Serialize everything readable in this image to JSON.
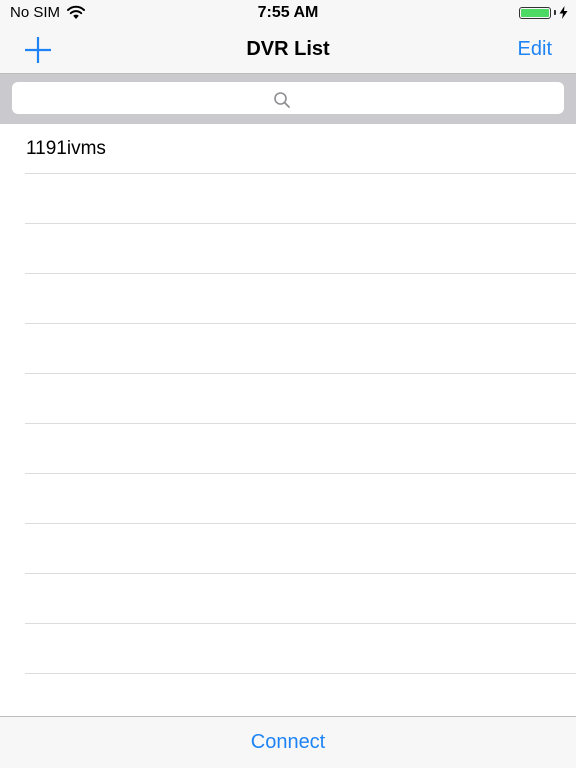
{
  "status_bar": {
    "carrier": "No SIM",
    "time": "7:55 AM",
    "battery_level": 1.0
  },
  "nav": {
    "title": "DVR List",
    "add_icon": "plus-icon",
    "edit_label": "Edit"
  },
  "search": {
    "placeholder": "",
    "value": "",
    "icon": "search-icon"
  },
  "list": {
    "items": [
      "1191ivms",
      "",
      "",
      "",
      "",
      "",
      "",
      "",
      "",
      "",
      "",
      ""
    ]
  },
  "toolbar": {
    "connect_label": "Connect"
  },
  "colors": {
    "accent": "#1e84f5",
    "bar_background": "#f7f7f7",
    "search_background": "#c9c9ce",
    "battery_fill": "#4cd964"
  }
}
